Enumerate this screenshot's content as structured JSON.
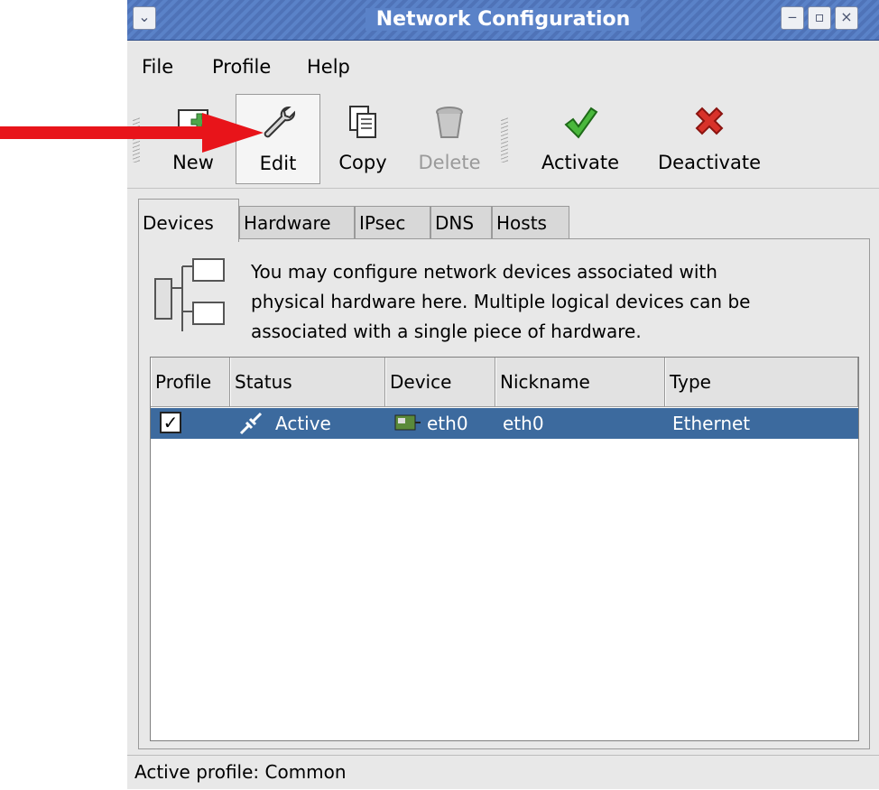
{
  "window": {
    "title": "Network Configuration"
  },
  "menu": [
    {
      "label": "File"
    },
    {
      "label": "Profile"
    },
    {
      "label": "Help"
    }
  ],
  "toolbar": [
    {
      "label": "New",
      "icon": "new-icon"
    },
    {
      "label": "Edit",
      "icon": "wrench-icon"
    },
    {
      "label": "Copy",
      "icon": "copy-icon"
    },
    {
      "label": "Delete",
      "icon": "trash-icon"
    },
    {
      "label": "Activate",
      "icon": "checkmark-icon"
    },
    {
      "label": "Deactivate",
      "icon": "red-x-icon"
    }
  ],
  "tabs": [
    {
      "label": "Devices"
    },
    {
      "label": "Hardware"
    },
    {
      "label": "IPsec"
    },
    {
      "label": "DNS"
    },
    {
      "label": "Hosts"
    }
  ],
  "devices_panel": {
    "description_lines": [
      "You may configure network devices associated with",
      "physical hardware here.  Multiple logical devices can be",
      "associated with a single piece of hardware."
    ],
    "columns": [
      "Profile",
      "Status",
      "Device",
      "Nickname",
      "Type"
    ],
    "rows": [
      {
        "profile_checked": "✓",
        "status": "Active",
        "device": "eth0",
        "nickname": "eth0",
        "type": "Ethernet"
      }
    ]
  },
  "statusbar": {
    "text": "Active profile: Common"
  },
  "colors": {
    "selection": "#3c6a9e",
    "arrow": "#e8141a",
    "titlebar": "#5a82c8"
  }
}
